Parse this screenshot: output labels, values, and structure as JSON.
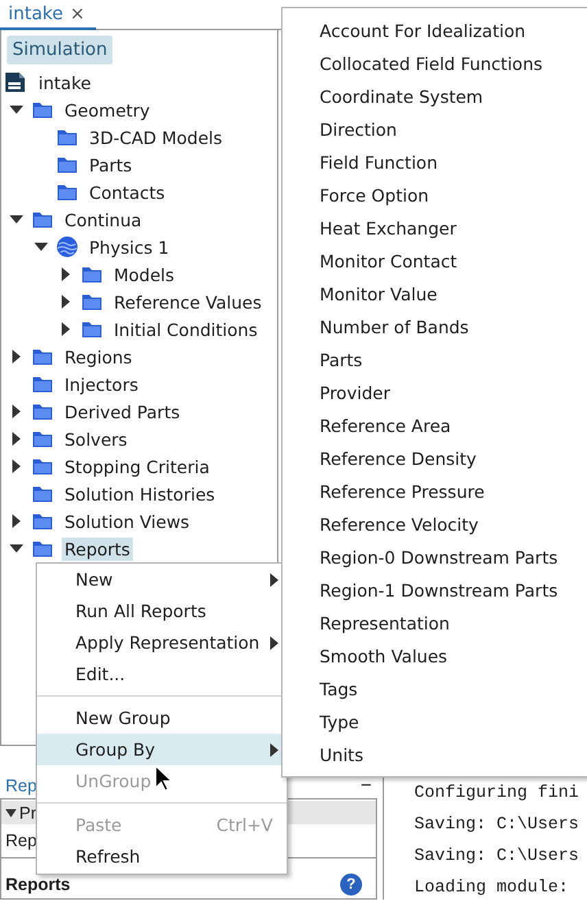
{
  "tab": {
    "label": "intake",
    "close": "×"
  },
  "panel_header": "Simulation",
  "tree": {
    "root": {
      "label": "intake",
      "kind": "file"
    },
    "items": [
      {
        "label": "Geometry",
        "kind": "folder",
        "expanded": true,
        "selected": false,
        "children": [
          {
            "label": "3D-CAD Models",
            "kind": "folder",
            "selected": false
          },
          {
            "label": "Parts",
            "kind": "folder",
            "selected": false
          },
          {
            "label": "Contacts",
            "kind": "folder",
            "selected": false
          }
        ]
      },
      {
        "label": "Continua",
        "kind": "folder",
        "expanded": true,
        "selected": false,
        "children": [
          {
            "label": "Physics 1",
            "kind": "physics",
            "expanded": true,
            "selected": false,
            "children": [
              {
                "label": "Models",
                "kind": "folder",
                "expanded": false,
                "selected": false
              },
              {
                "label": "Reference Values",
                "kind": "folder",
                "expanded": false,
                "selected": false
              },
              {
                "label": "Initial Conditions",
                "kind": "folder",
                "expanded": false,
                "selected": false
              }
            ]
          }
        ]
      },
      {
        "label": "Regions",
        "kind": "folder",
        "expanded": false,
        "selected": false
      },
      {
        "label": "Injectors",
        "kind": "folder",
        "selected": false
      },
      {
        "label": "Derived Parts",
        "kind": "folder",
        "expanded": false,
        "selected": false
      },
      {
        "label": "Solvers",
        "kind": "folder",
        "expanded": false,
        "selected": false
      },
      {
        "label": "Stopping Criteria",
        "kind": "folder",
        "expanded": false,
        "selected": false
      },
      {
        "label": "Solution Histories",
        "kind": "folder",
        "selected": false
      },
      {
        "label": "Solution Views",
        "kind": "folder",
        "expanded": false,
        "selected": false
      },
      {
        "label": "Reports",
        "kind": "folder",
        "expanded": true,
        "selected": true
      }
    ]
  },
  "context_menu": [
    {
      "kind": "item",
      "label": "New",
      "submenu": true,
      "disabled": false,
      "selected": false
    },
    {
      "kind": "item",
      "label": "Run All Reports",
      "submenu": false,
      "disabled": false,
      "selected": false
    },
    {
      "kind": "item",
      "label": "Apply Representation",
      "submenu": true,
      "disabled": false,
      "selected": false
    },
    {
      "kind": "item",
      "label": "Edit...",
      "submenu": false,
      "disabled": false,
      "selected": false
    },
    {
      "kind": "separator"
    },
    {
      "kind": "item",
      "label": "New Group",
      "submenu": false,
      "disabled": false,
      "selected": false
    },
    {
      "kind": "item",
      "label": "Group By",
      "submenu": true,
      "disabled": false,
      "selected": true
    },
    {
      "kind": "item",
      "label": "UnGroup",
      "submenu": false,
      "disabled": true,
      "selected": false
    },
    {
      "kind": "separator"
    },
    {
      "kind": "item",
      "label": "Paste",
      "shortcut": "Ctrl+V",
      "submenu": false,
      "disabled": true,
      "selected": false
    },
    {
      "kind": "item",
      "label": "Refresh",
      "submenu": false,
      "disabled": false,
      "selected": false
    }
  ],
  "submenu": [
    "Account For Idealization",
    "Collocated Field Functions",
    "Coordinate System",
    "Direction",
    "Field Function",
    "Force Option",
    "Heat Exchanger",
    "Monitor Contact",
    "Monitor Value",
    "Number of Bands",
    "Parts",
    "Provider",
    "Reference Area",
    "Reference Density",
    "Reference Pressure",
    "Reference Velocity",
    "Region-0 Downstream Parts",
    "Region-1 Downstream Parts",
    "Representation",
    "Smooth Values",
    "Tags",
    "Type",
    "Units"
  ],
  "bottom_panel": {
    "tab": "Rep",
    "minimize": "−",
    "header": "Pr",
    "row": "Rep",
    "title": "Reports",
    "help": "?"
  },
  "console": {
    "lines": [
      "Configuring fini",
      "Saving: C:\\Users",
      "Saving: C:\\Users",
      "Loading module:"
    ]
  }
}
